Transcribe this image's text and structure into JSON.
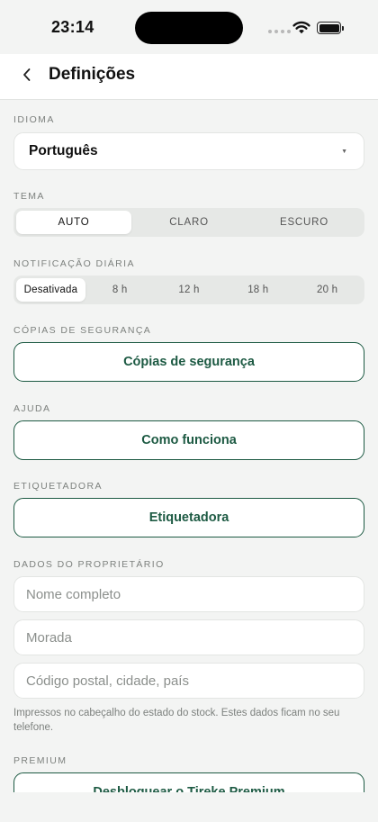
{
  "status_bar": {
    "time": "23:14"
  },
  "nav": {
    "title": "Definições"
  },
  "sections": {
    "language": {
      "label": "Idioma",
      "value": "Português"
    },
    "theme": {
      "label": "Tema",
      "options": [
        "AUTO",
        "CLARO",
        "ESCURO"
      ],
      "selected": "AUTO"
    },
    "notification": {
      "label": "Notificação diária",
      "options": [
        "Desativada",
        "8 h",
        "12 h",
        "18 h",
        "20 h"
      ],
      "selected": "Desativada"
    },
    "backups": {
      "label": "Cópias de segurança",
      "button": "Cópias de segurança"
    },
    "help": {
      "label": "Ajuda",
      "button": "Como funciona"
    },
    "labeler": {
      "label": "Etiquetadora",
      "button": "Etiquetadora"
    },
    "owner": {
      "label": "Dados do proprietário",
      "name_placeholder": "Nome completo",
      "address_placeholder": "Morada",
      "postal_placeholder": "Código postal, cidade, país",
      "hint": "Impressos no cabeçalho do estado do stock. Estes dados ficam no seu telefone."
    },
    "premium": {
      "label": "Premium",
      "button": "Desbloquear o Tireke Premium"
    }
  },
  "colors": {
    "accent": "#1d5a43",
    "background": "#f3f4f3"
  }
}
